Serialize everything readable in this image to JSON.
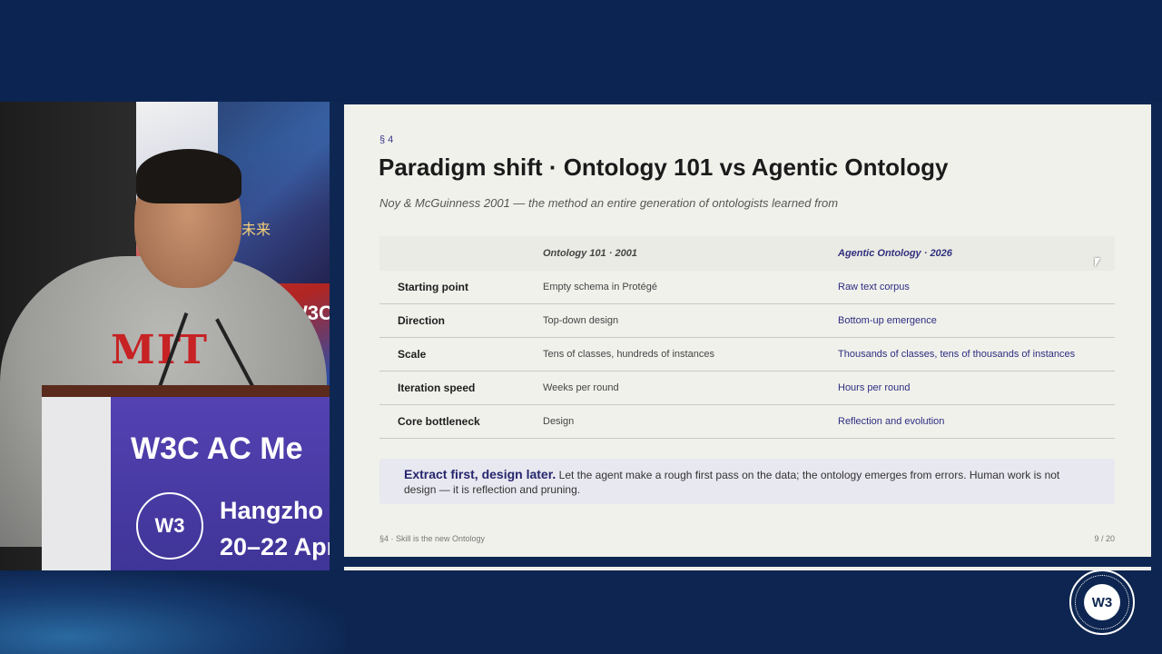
{
  "camera": {
    "shirt_text": "MIT",
    "podium_line1": "W3C AC Me",
    "podium_line2": "Hangzho",
    "podium_line3": "20–22 Apr",
    "backdrop_text": "W3C",
    "backdrop_cn": "网未来"
  },
  "slide": {
    "section_tag": "§ 4",
    "title": "Paradigm shift · Ontology 101 vs Agentic Ontology",
    "subtitle": "Noy & McGuinness 2001 — the method an entire generation of ontologists learned from",
    "table": {
      "headers": [
        "",
        "Ontology 101 · 2001",
        "Agentic Ontology · 2026"
      ],
      "rows": [
        [
          "Starting point",
          "Empty schema in Protégé",
          "Raw text corpus"
        ],
        [
          "Direction",
          "Top-down design",
          "Bottom-up emergence"
        ],
        [
          "Scale",
          "Tens of classes, hundreds of instances",
          "Thousands of classes, tens of thousands of instances"
        ],
        [
          "Iteration speed",
          "Weeks per round",
          "Hours per round"
        ],
        [
          "Core bottleneck",
          "Design",
          "Reflection and evolution"
        ]
      ]
    },
    "callout": {
      "lead": "Extract first, design later.",
      "body": "Let the agent make a rough first pass on the data; the ontology emerges from errors. Human work is not design — it is reflection and pruning."
    },
    "footer_left": "§4 · Skill is the new Ontology",
    "footer_right": "9 / 20"
  },
  "badge": {
    "icon": "w3c-logo-icon",
    "text": "W3"
  }
}
